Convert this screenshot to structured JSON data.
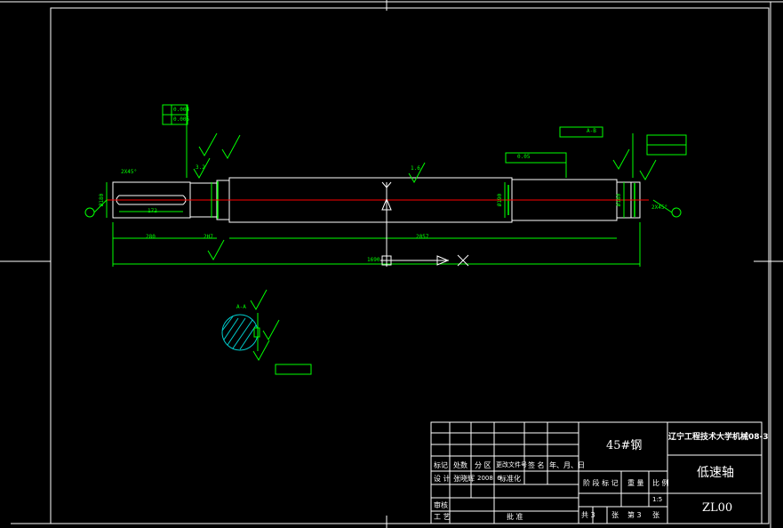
{
  "drawing": {
    "part_name": "低速轴",
    "material": "45#钢",
    "school": "辽宁工程技术大学机械08-3",
    "code": "ZL00",
    "scale": "1:5"
  },
  "title_block": {
    "row_labels": [
      "标记",
      "处数",
      "分 区",
      "更改文件号",
      "签 名",
      "年、月、日"
    ],
    "design_row": [
      "设 计",
      "张晓辉",
      "2008. 6",
      "标准化"
    ],
    "review": "审核",
    "process": "工 艺",
    "approve": "批 准",
    "stage_labels": [
      "阶 段 标 记",
      "重 量",
      "比 例"
    ],
    "sheet_info": [
      "共 3",
      "张",
      "第 3",
      "张"
    ]
  },
  "dimensions": {
    "chamfer_left": "2X45°",
    "chamfer_right": "2X45°",
    "key_length": "172",
    "left_seg": "280",
    "left_step": "2H7",
    "mid_len": "2057",
    "total_len": "1690",
    "section_label": "A-A",
    "rough_1": "1.6",
    "rough_2": "3.2",
    "tol_1": "0.004",
    "tol_2": "0.005",
    "tol_3": "0.05",
    "datum_a": "A-B",
    "diam_left": "Ø180",
    "diam_mid": "Ø190",
    "diam_right": "Ø180"
  },
  "colors": {
    "background": "#000000",
    "lines": "#ffffff",
    "dimension": "#00ff00",
    "centerline": "#ff0000",
    "section_fill": "#00cccc"
  }
}
